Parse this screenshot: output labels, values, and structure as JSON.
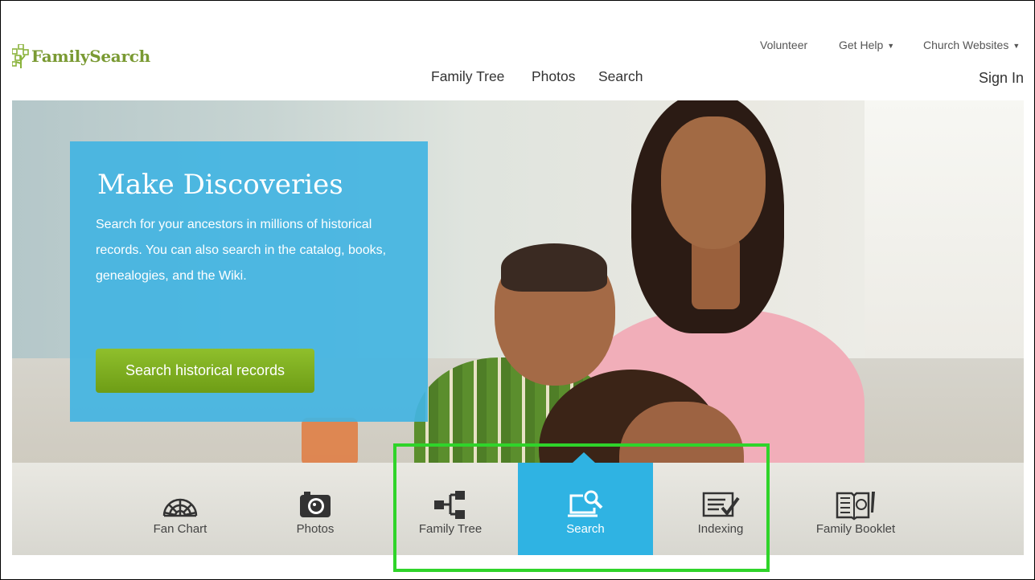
{
  "brand": {
    "name": "FamilySearch",
    "color": "#7a9a33"
  },
  "utility_nav": [
    {
      "label": "Volunteer"
    },
    {
      "label": "Get Help"
    },
    {
      "label": "Church Websites"
    }
  ],
  "main_nav": [
    {
      "label": "Family Tree"
    },
    {
      "label": "Photos"
    },
    {
      "label": "Search"
    }
  ],
  "sign_in": "Sign In",
  "hero": {
    "title": "Make Discoveries",
    "text": "Search for your ancestors in millions of historical records. You can also search in the catalog, books, genealogies, and the Wiki.",
    "button": "Search historical records",
    "panel_color": "#42b4e2",
    "button_color": "#7aab1f"
  },
  "features": [
    {
      "label": "Fan Chart",
      "icon": "fan-chart-icon",
      "active": false
    },
    {
      "label": "Photos",
      "icon": "camera-icon",
      "active": false
    },
    {
      "label": "Family Tree",
      "icon": "family-tree-icon",
      "active": false
    },
    {
      "label": "Search",
      "icon": "search-computer-icon",
      "active": true
    },
    {
      "label": "Indexing",
      "icon": "indexing-icon",
      "active": false
    },
    {
      "label": "Family Booklet",
      "icon": "booklet-icon",
      "active": false
    }
  ],
  "colors": {
    "active_tab": "#2fb3e3",
    "highlight_box": "#2fd42a"
  }
}
